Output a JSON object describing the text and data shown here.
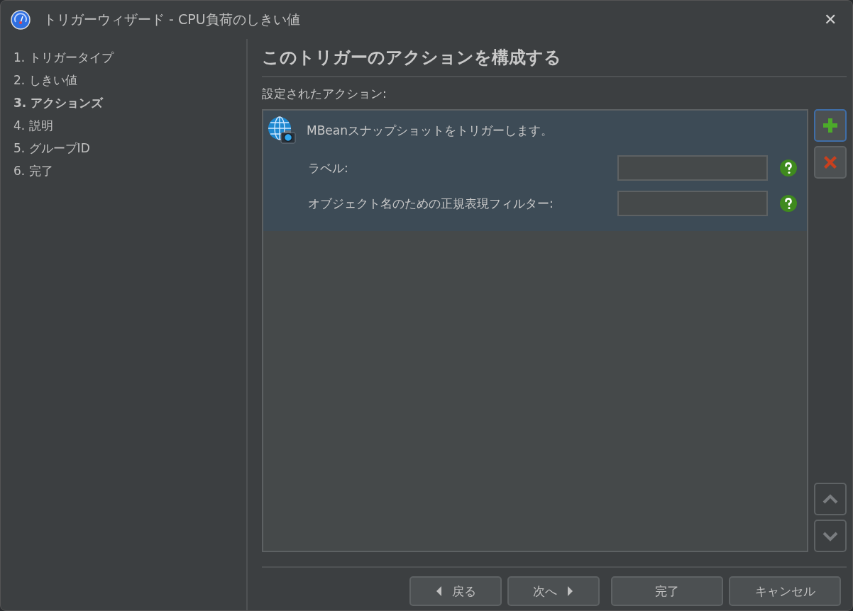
{
  "window": {
    "title": "トリガーウィザード - CPU負荷のしきい値",
    "close": "✕"
  },
  "steps": [
    {
      "label": "1. トリガータイプ",
      "selected": false
    },
    {
      "label": "2. しきい値",
      "selected": false
    },
    {
      "label": "3. アクションズ",
      "selected": true
    },
    {
      "label": "4. 説明",
      "selected": false
    },
    {
      "label": "5. グループID",
      "selected": false
    },
    {
      "label": "6. 完了",
      "selected": false
    }
  ],
  "heading": "このトリガーのアクションを構成する",
  "list_label": "設定されたアクション:",
  "actions": [
    {
      "title": "MBeanスナップショットをトリガーします。",
      "selected": true,
      "fields": [
        {
          "label": "ラベル:"
        },
        {
          "label": "オブジェクト名のための正規表現フィルター:"
        }
      ]
    }
  ],
  "side_buttons": [
    {
      "kind": "add",
      "focused": true,
      "disabled": false
    },
    {
      "kind": "remove",
      "focused": false,
      "disabled": false
    },
    {
      "kind": "up",
      "focused": false,
      "disabled": true
    },
    {
      "kind": "down",
      "focused": false,
      "disabled": true
    }
  ],
  "buttons": [
    {
      "kind": "back",
      "label": "戻る"
    },
    {
      "kind": "next",
      "label": "次へ"
    },
    {
      "kind": "plain",
      "label": "完了"
    },
    {
      "kind": "plain",
      "label": "キャンセル"
    }
  ]
}
